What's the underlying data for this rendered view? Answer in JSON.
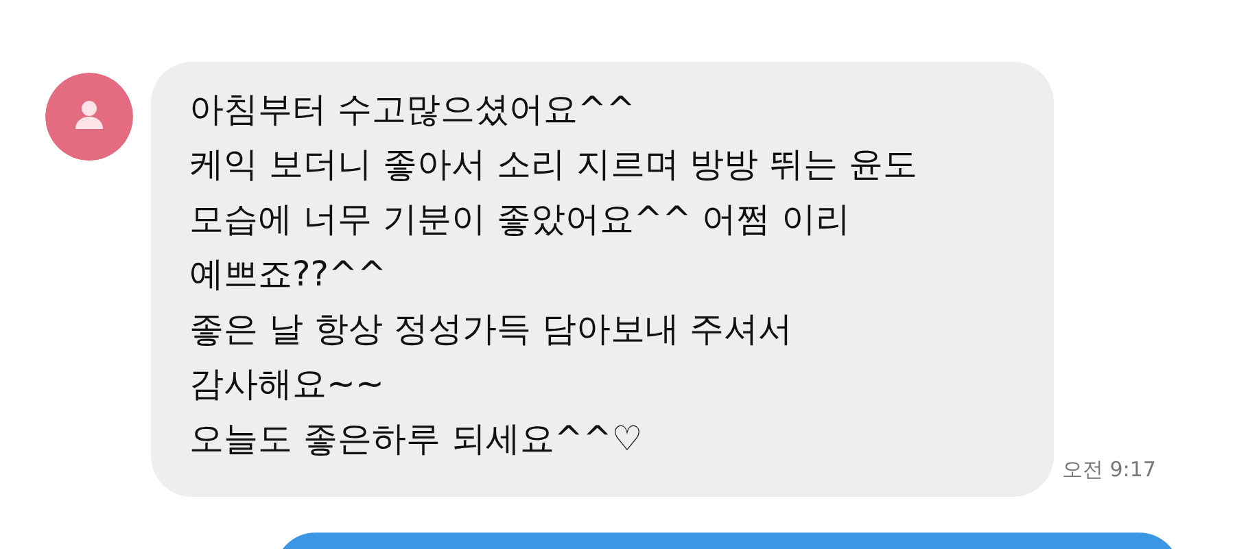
{
  "messages": [
    {
      "kind": "incoming",
      "avatar": {
        "color": "#e46c80"
      },
      "text": "아침부터 수고많으셨어요^^\n케익 보더니 좋아서 소리 지르며 방방 뛰는 윤도\n모습에 너무 기분이 좋았어요^^ 어쩜 이리\n예쁘죠??^^\n좋은 날 항상 정성가득 담아보내 주셔서\n감사해요~~\n오늘도 좋은하루 되세요^^♡",
      "time": "오전 9:17"
    },
    {
      "kind": "outgoing"
    }
  ]
}
